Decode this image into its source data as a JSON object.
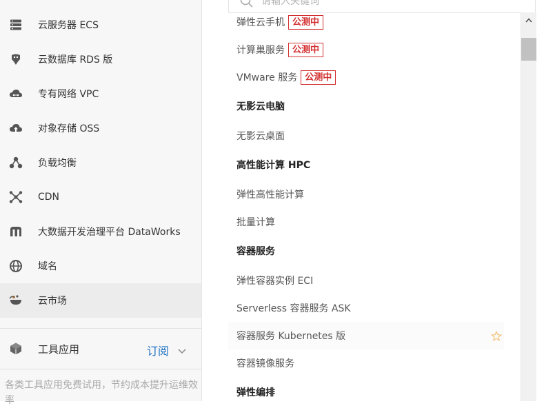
{
  "sidebar": {
    "items": [
      {
        "label": "云服务器 ECS",
        "icon": "server-icon"
      },
      {
        "label": "云数据库 RDS 版",
        "icon": "database-icon"
      },
      {
        "label": "专有网络 VPC",
        "icon": "cloud-network-icon"
      },
      {
        "label": "对象存储 OSS",
        "icon": "cloud-storage-icon"
      },
      {
        "label": "负载均衡",
        "icon": "load-balancer-icon"
      },
      {
        "label": "CDN",
        "icon": "cdn-icon"
      },
      {
        "label": "大数据开发治理平台 DataWorks",
        "icon": "dataworks-icon"
      },
      {
        "label": "域名",
        "icon": "globe-icon"
      },
      {
        "label": "云市场",
        "icon": "marketplace-icon"
      }
    ],
    "tools": {
      "label": "工具应用",
      "subscribe": "订阅",
      "description": "各类工具应用免费试用，节约成本提升运维效率"
    }
  },
  "search": {
    "placeholder": "请输入关键词"
  },
  "products": {
    "tag_label": "公测中",
    "rows": [
      {
        "text": "弹性云手机",
        "tag": true
      },
      {
        "text": "计算巢服务",
        "tag": true
      },
      {
        "text": "VMware 服务",
        "tag": true
      }
    ],
    "groups": [
      {
        "heading": "无影云电脑",
        "items": [
          "无影云桌面"
        ]
      },
      {
        "heading": "高性能计算 HPC",
        "items": [
          "弹性高性能计算",
          "批量计算"
        ]
      },
      {
        "heading": "容器服务",
        "items": [
          "弹性容器实例 ECI",
          "Serverless 容器服务 ASK",
          "容器服务 Kubernetes 版",
          "容器镜像服务"
        ]
      },
      {
        "heading": "弹性编排",
        "items": []
      }
    ]
  },
  "colors": {
    "accent": "#1a6fc4",
    "tag": "#d32f2f",
    "star": "#f5c27a"
  }
}
